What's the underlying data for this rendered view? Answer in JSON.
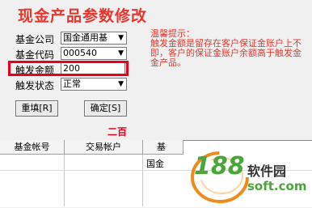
{
  "page": {
    "title": "现金产品参数修改"
  },
  "form": {
    "fund_company": {
      "label": "基金公司",
      "value": "国金通用基"
    },
    "fund_code": {
      "label": "基金代码",
      "value": "000540"
    },
    "trigger_amount": {
      "label": "触发金额",
      "value": "200"
    },
    "trigger_status": {
      "label": "触发状态",
      "value": "正常"
    }
  },
  "buttons": {
    "reset": "重填[R]",
    "confirm": "确定[S]"
  },
  "tip": {
    "heading": "温馨提示：",
    "lines": [
      "触发金额是留存在客户保证金账户上不",
      "即，客户的保证金账户余额高于触发金",
      "金产品。"
    ]
  },
  "amount_in_words": "二百",
  "table": {
    "headers": [
      "基金帐号",
      "交易帐户",
      "基"
    ],
    "row_cells": [
      "国金"
    ]
  },
  "watermark": {
    "number": "188",
    "brand": "软件园",
    "domain": "soft.com"
  },
  "colors": {
    "accent_red": "#e8352d",
    "highlight": "#e8001c",
    "watermark_orange": "#f08a1c",
    "watermark_green": "#4aa63a"
  }
}
